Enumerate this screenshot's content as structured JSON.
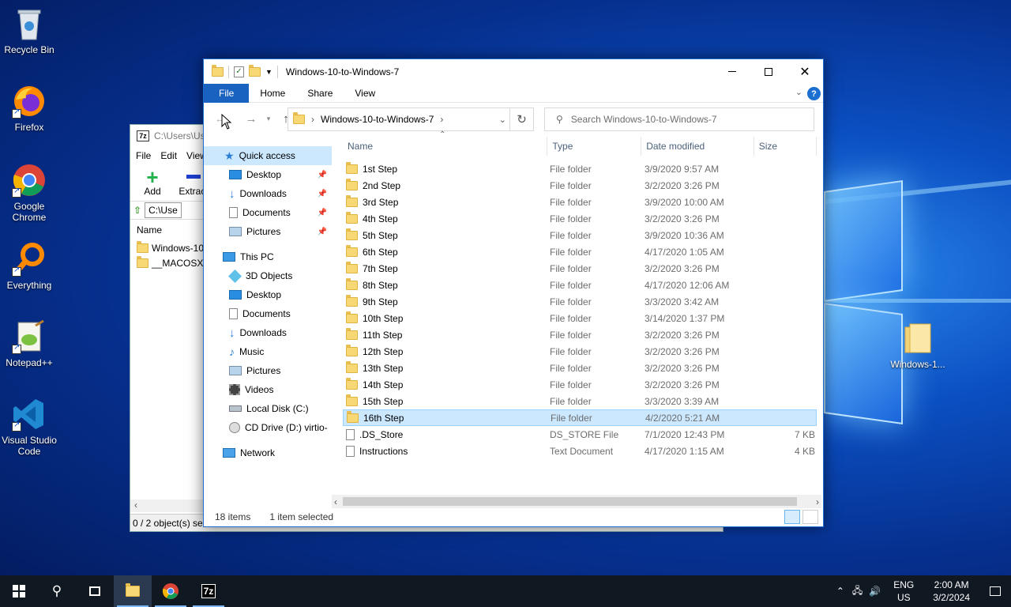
{
  "desktop": {
    "icons": [
      {
        "label": "Recycle Bin",
        "icon": "recycle-bin-icon"
      },
      {
        "label": "Firefox",
        "icon": "firefox-icon"
      },
      {
        "label": "Google Chrome",
        "icon": "chrome-icon"
      },
      {
        "label": "Everything",
        "icon": "everything-search-icon"
      },
      {
        "label": "Notepad++",
        "icon": "notepadpp-icon"
      },
      {
        "label": "Visual Studio Code",
        "icon": "vscode-icon"
      },
      {
        "label": "Windows-1...",
        "icon": "folder-icon"
      }
    ]
  },
  "zip_window": {
    "title": "C:\\Users\\Us",
    "menu": [
      "File",
      "Edit",
      "View"
    ],
    "toolbar": {
      "add": "Add",
      "extract": "Extract"
    },
    "address": "C:\\Use",
    "column_name": "Name",
    "items": [
      "Windows-10-",
      "__MACOSX"
    ],
    "status": "0 / 2 object(s) sele"
  },
  "explorer": {
    "title": "Windows-10-to-Windows-7",
    "ribbon_tabs": [
      "File",
      "Home",
      "Share",
      "View"
    ],
    "address_path": "Windows-10-to-Windows-7",
    "search_placeholder": "Search Windows-10-to-Windows-7",
    "nav": {
      "quick_access": "Quick access",
      "quick_items": [
        "Desktop",
        "Downloads",
        "Documents",
        "Pictures"
      ],
      "this_pc": "This PC",
      "pc_items": [
        "3D Objects",
        "Desktop",
        "Documents",
        "Downloads",
        "Music",
        "Pictures",
        "Videos",
        "Local Disk (C:)",
        "CD Drive (D:) virtio-"
      ],
      "network": "Network"
    },
    "columns": {
      "name": "Name",
      "type": "Type",
      "date": "Date modified",
      "size": "Size"
    },
    "files": [
      {
        "name": "1st Step",
        "type": "File folder",
        "date": "3/9/2020 9:57 AM",
        "size": ""
      },
      {
        "name": "2nd Step",
        "type": "File folder",
        "date": "3/2/2020 3:26 PM",
        "size": ""
      },
      {
        "name": "3rd Step",
        "type": "File folder",
        "date": "3/9/2020 10:00 AM",
        "size": ""
      },
      {
        "name": "4th Step",
        "type": "File folder",
        "date": "3/2/2020 3:26 PM",
        "size": ""
      },
      {
        "name": "5th Step",
        "type": "File folder",
        "date": "3/9/2020 10:36 AM",
        "size": ""
      },
      {
        "name": "6th Step",
        "type": "File folder",
        "date": "4/17/2020 1:05 AM",
        "size": ""
      },
      {
        "name": "7th Step",
        "type": "File folder",
        "date": "3/2/2020 3:26 PM",
        "size": ""
      },
      {
        "name": "8th Step",
        "type": "File folder",
        "date": "4/17/2020 12:06 AM",
        "size": ""
      },
      {
        "name": "9th Step",
        "type": "File folder",
        "date": "3/3/2020 3:42 AM",
        "size": ""
      },
      {
        "name": "10th Step",
        "type": "File folder",
        "date": "3/14/2020 1:37 PM",
        "size": ""
      },
      {
        "name": "11th Step",
        "type": "File folder",
        "date": "3/2/2020 3:26 PM",
        "size": ""
      },
      {
        "name": "12th Step",
        "type": "File folder",
        "date": "3/2/2020 3:26 PM",
        "size": ""
      },
      {
        "name": "13th Step",
        "type": "File folder",
        "date": "3/2/2020 3:26 PM",
        "size": ""
      },
      {
        "name": "14th Step",
        "type": "File folder",
        "date": "3/2/2020 3:26 PM",
        "size": ""
      },
      {
        "name": "15th Step",
        "type": "File folder",
        "date": "3/3/2020 3:39 AM",
        "size": ""
      },
      {
        "name": "16th Step",
        "type": "File folder",
        "date": "4/2/2020 5:21 AM",
        "size": "",
        "selected": true
      },
      {
        "name": ".DS_Store",
        "type": "DS_STORE File",
        "date": "7/1/2020 12:43 PM",
        "size": "7 KB"
      },
      {
        "name": "Instructions",
        "type": "Text Document",
        "date": "4/17/2020 1:15 AM",
        "size": "4 KB"
      }
    ],
    "status_count": "18 items",
    "status_selected": "1 item selected"
  },
  "taskbar": {
    "items": [
      "start-icon",
      "search-icon",
      "task-view-icon",
      "file-explorer-icon",
      "chrome-icon",
      "7zip-icon"
    ],
    "seven_zip_label": "7z",
    "lang_top": "ENG",
    "lang_bottom": "US",
    "time": "2:00 AM",
    "date": "3/2/2024"
  }
}
